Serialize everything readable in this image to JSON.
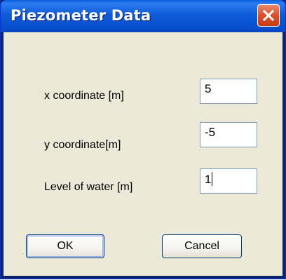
{
  "window": {
    "title": "Piezometer Data"
  },
  "fields": [
    {
      "label": "x coordinate [m]",
      "value": "5"
    },
    {
      "label": "y coordinate[m]",
      "value": "-5"
    },
    {
      "label": "Level of water [m]",
      "value": "1"
    }
  ],
  "buttons": {
    "ok_label": "OK",
    "cancel_label": "Cancel"
  },
  "icons": {
    "close": "close-icon"
  },
  "colors": {
    "titlebar": "#0851d0",
    "close_button": "#d9512b",
    "dialog_background": "#ece9d8",
    "input_border": "#7f9db9"
  }
}
